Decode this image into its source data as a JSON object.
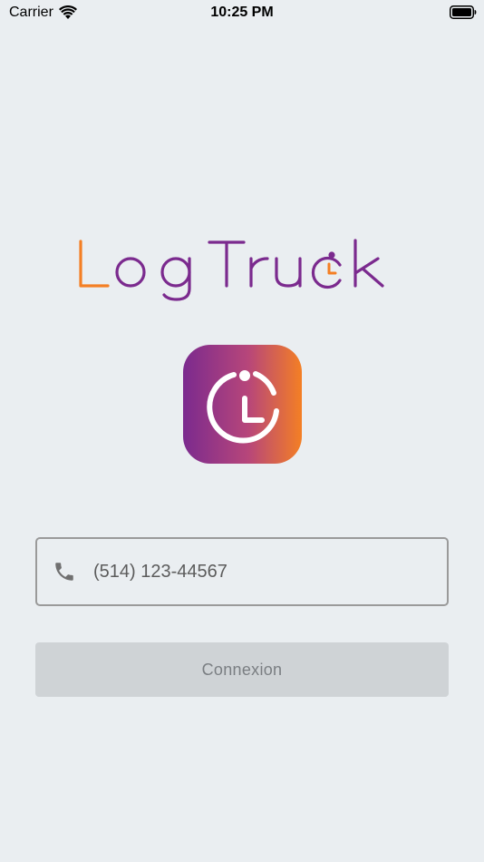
{
  "status_bar": {
    "carrier": "Carrier",
    "time": "10:25 PM",
    "icons": [
      "wifi-icon",
      "battery-icon"
    ]
  },
  "brand": {
    "name": "Log Truck",
    "colors": {
      "orange": "#f47f24",
      "purple": "#7b2a8e"
    }
  },
  "app_icon": {
    "icon": "clock-icon",
    "gradient": [
      "#7b2a8e",
      "#f47f24"
    ]
  },
  "login_form": {
    "phone_icon": "phone-icon",
    "phone_placeholder": "(514) 123-44567",
    "submit_label": "Connexion"
  },
  "theme": {
    "background": "#eaeef1",
    "button_background": "#cfd3d6",
    "button_text": "#7a7e82",
    "field_border": "#9a9a9a"
  }
}
